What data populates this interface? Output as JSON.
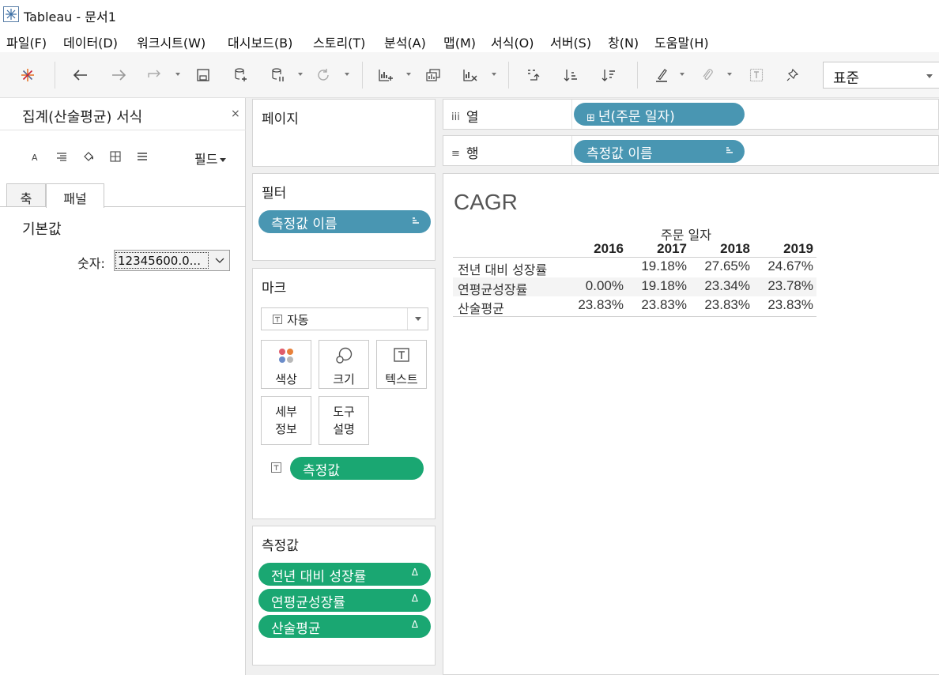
{
  "window": {
    "title": "Tableau - 문서1"
  },
  "menu": [
    "파일(F)",
    "데이터(D)",
    "워크시트(W)",
    "대시보드(B)",
    "스토리(T)",
    "분석(A)",
    "맵(M)",
    "서식(O)",
    "서버(S)",
    "창(N)",
    "도움말(H)"
  ],
  "toolbar": {
    "fit_value": "표준"
  },
  "format_pane": {
    "title": "집계(산술평균) 서식",
    "close": "×",
    "field_dropdown": "필드",
    "tabs": [
      "축",
      "패널"
    ],
    "active_tab": "패널",
    "section": "기본값",
    "number_label": "숫자:",
    "number_value": "12345600.0..."
  },
  "pages": {
    "title": "페이지"
  },
  "filters": {
    "title": "필터",
    "pill": "측정값 이름"
  },
  "marks": {
    "title": "마크",
    "type": "자동",
    "buttons": {
      "color": "색상",
      "size": "크기",
      "text": "텍스트",
      "detail": "세부\n정보",
      "detail_1": "세부",
      "detail_2": "정보",
      "tooltip_1": "도구",
      "tooltip_2": "설명"
    },
    "pill": "측정값"
  },
  "measure_values": {
    "title": "측정값",
    "items": [
      "전년 대비 성장률",
      "연평균성장률",
      "산술평균"
    ],
    "delta": "Δ"
  },
  "shelves": {
    "columns": {
      "label": "열",
      "icon": "iii",
      "pill": "년(주문 일자)"
    },
    "rows": {
      "label": "행",
      "icon": "≡",
      "pill": "측정값 이름"
    }
  },
  "viz": {
    "title": "CAGR",
    "column_header": "주문 일자",
    "years": [
      "2016",
      "2017",
      "2018",
      "2019"
    ],
    "rows": [
      {
        "label": "전년 대비 성장률",
        "values": [
          "",
          "19.18%",
          "27.65%",
          "24.67%"
        ]
      },
      {
        "label": "연평균성장률",
        "values": [
          "0.00%",
          "19.18%",
          "23.34%",
          "23.78%"
        ]
      },
      {
        "label": "산술평균",
        "values": [
          "23.83%",
          "23.83%",
          "23.83%",
          "23.83%"
        ]
      }
    ]
  },
  "colors": {
    "dimension_pill": "#4996b2",
    "measure_pill": "#1aa772"
  }
}
